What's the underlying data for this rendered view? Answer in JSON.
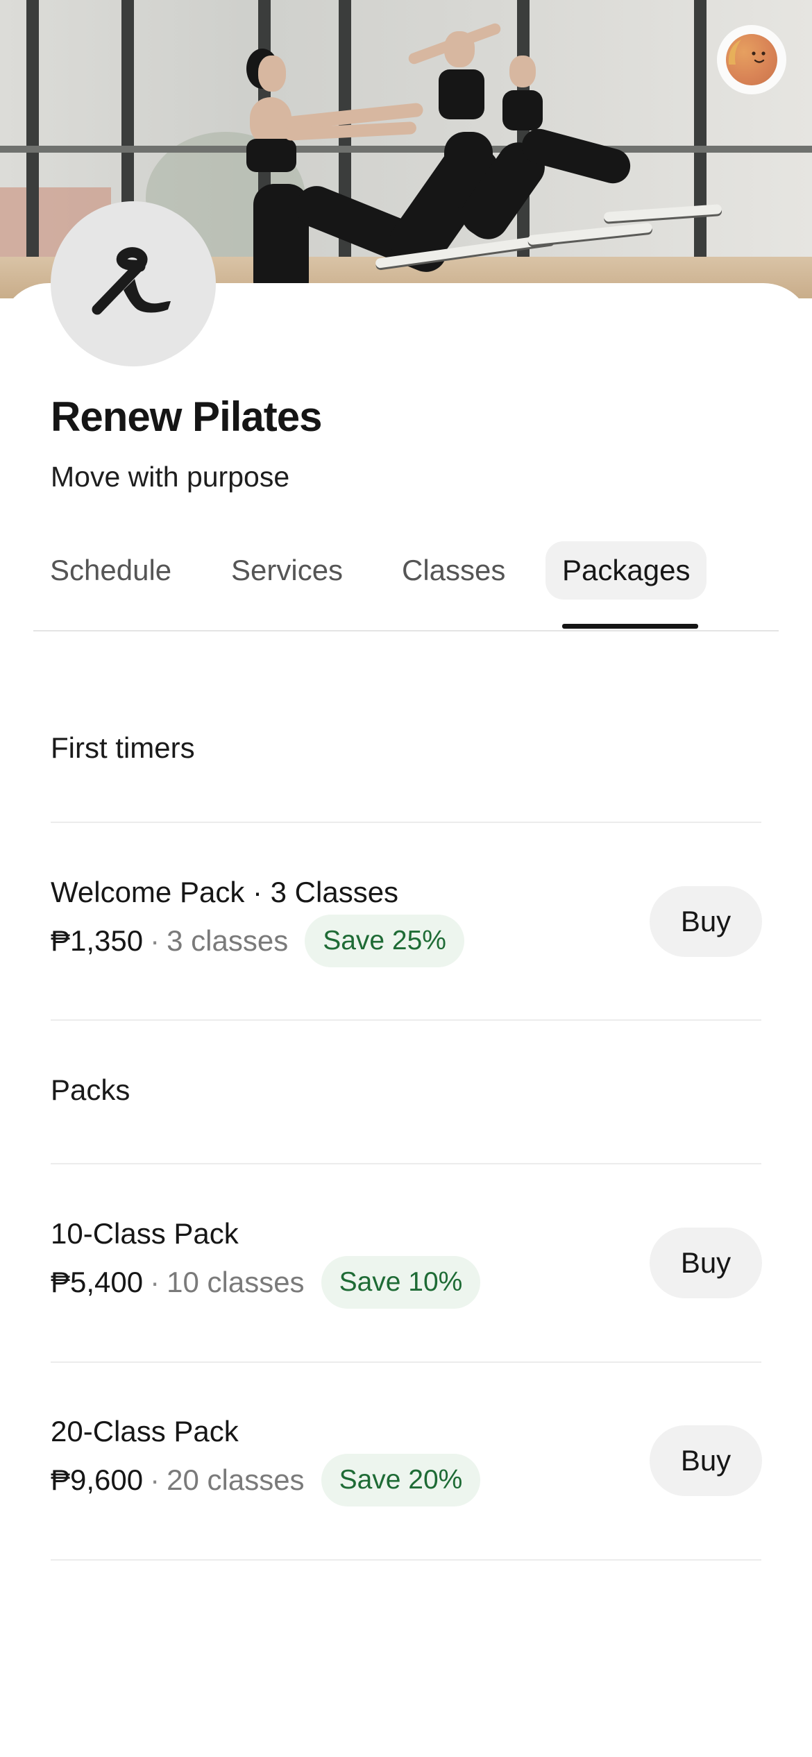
{
  "colors": {
    "accent": "#151515",
    "badge_bg": "#edf5ee",
    "badge_text": "#1e6b35",
    "button_bg": "#f1f1f1"
  },
  "header": {
    "hero_image": "pilates-reformer-class-photo",
    "profile_icon": "avatar-face-icon"
  },
  "studio": {
    "logo_icon": "studio-logo-mark",
    "name": "Renew Pilates",
    "tagline": "Move with purpose"
  },
  "tabs": [
    {
      "label": "Schedule",
      "active": false
    },
    {
      "label": "Services",
      "active": false
    },
    {
      "label": "Classes",
      "active": false
    },
    {
      "label": "Packages",
      "active": true
    }
  ],
  "sections": [
    {
      "heading": "First timers",
      "packages": [
        {
          "name": "Welcome Pack · 3 Classes",
          "price": "₱1,350",
          "separator": "·",
          "classes": "3 classes",
          "badge": "Save 25%",
          "button": "Buy"
        }
      ]
    },
    {
      "heading": "Packs",
      "packages": [
        {
          "name": "10-Class Pack",
          "price": "₱5,400",
          "separator": "·",
          "classes": "10 classes",
          "badge": "Save 10%",
          "button": "Buy"
        },
        {
          "name": "20-Class Pack",
          "price": "₱9,600",
          "separator": "·",
          "classes": "20 classes",
          "badge": "Save 20%",
          "button": "Buy"
        }
      ]
    }
  ]
}
